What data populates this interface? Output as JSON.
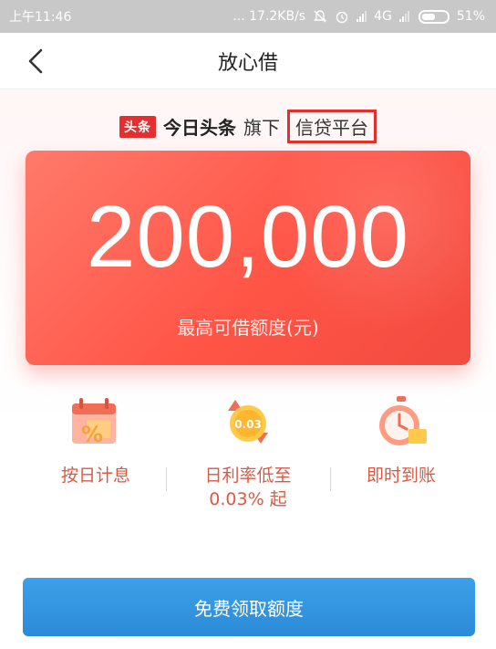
{
  "status_bar": {
    "time": "上午11:46",
    "network_speed": "... 17.2KB/s",
    "network_type": "4G",
    "battery": "51%"
  },
  "nav": {
    "title": "放心借",
    "back_icon": "chevron-left-icon"
  },
  "brand": {
    "logo_text": "头条",
    "name": "今日头条",
    "prefix": "旗下",
    "highlight": "信贷平台"
  },
  "card": {
    "amount": "200,000",
    "caption": "最高可借额度(元)"
  },
  "features": [
    {
      "icon": "calendar-percent-icon",
      "label": "按日计息"
    },
    {
      "icon": "coin-rate-icon",
      "label": "日利率低至\n0.03% 起"
    },
    {
      "icon": "stopwatch-icon",
      "label": "即时到账"
    }
  ],
  "cta": {
    "label": "免费领取额度"
  },
  "colors": {
    "card_red": "#ff5547",
    "feature_text": "#d95a45",
    "cta_blue": "#2a8ad8",
    "highlight_border": "#e0322c"
  }
}
